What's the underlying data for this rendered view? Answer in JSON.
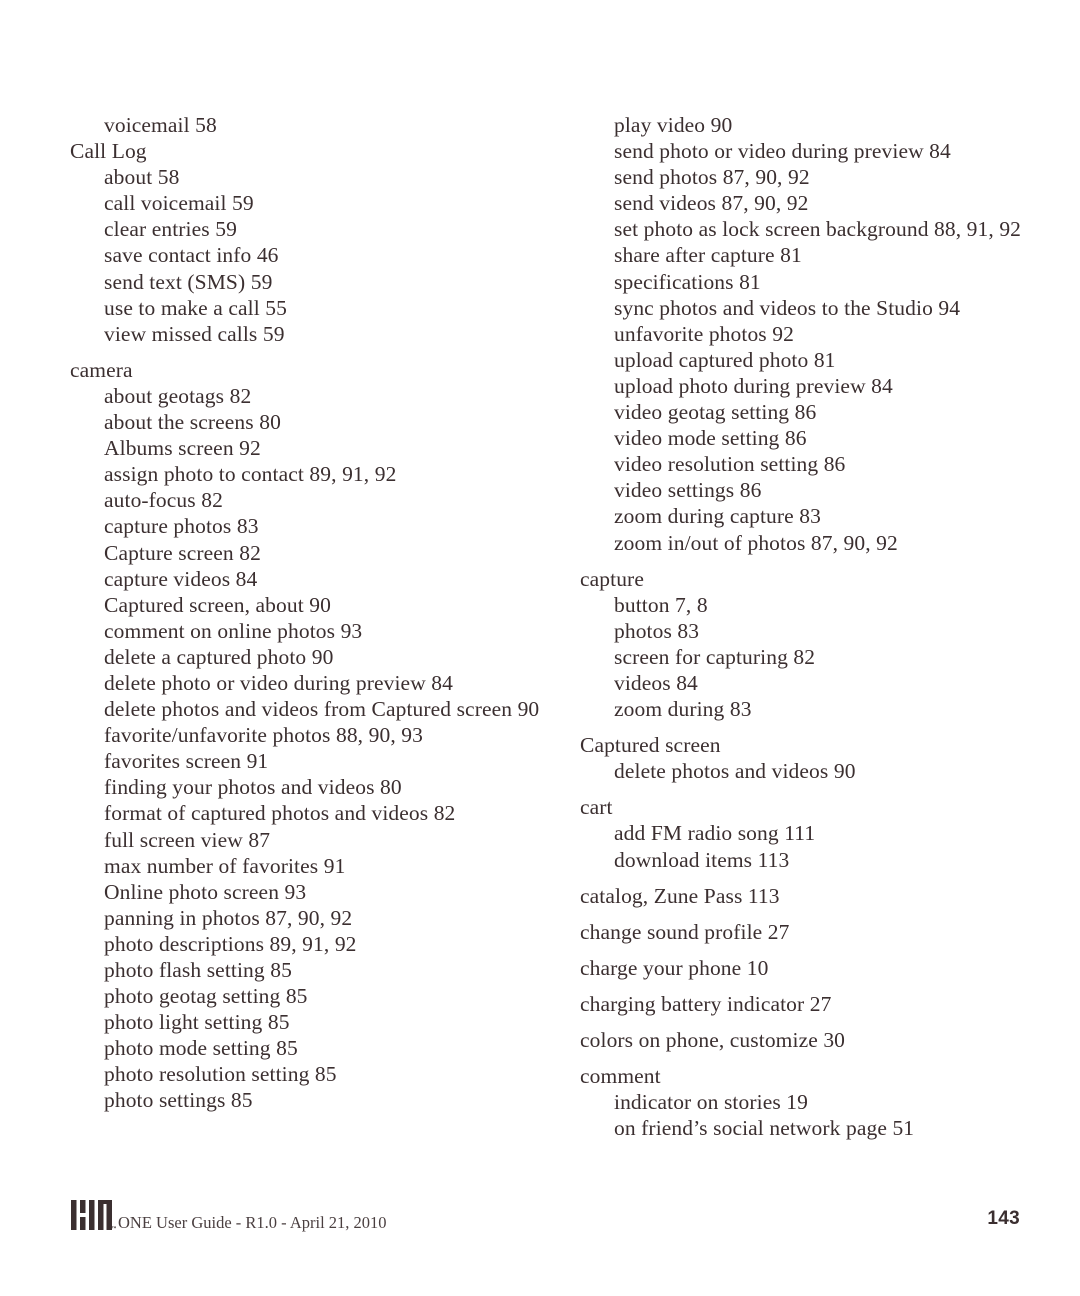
{
  "document": {
    "type": "index",
    "page_number": "143",
    "footer_text": "ONE User Guide - R1.0 - April 21, 2010",
    "logo_name": "KIN",
    "logo_trademark": "TM",
    "text_color": "#3b2f30"
  },
  "columns": [
    {
      "id": "left",
      "entries": [
        {
          "level": 2,
          "text": "voicemail  58"
        },
        {
          "level": 1,
          "text": "Call Log"
        },
        {
          "level": 2,
          "text": "about  58"
        },
        {
          "level": 2,
          "text": "call voicemail  59"
        },
        {
          "level": 2,
          "text": "clear entries  59"
        },
        {
          "level": 2,
          "text": "save contact info  46"
        },
        {
          "level": 2,
          "text": "send text (SMS) 59"
        },
        {
          "level": 2,
          "text": "use to make a call  55"
        },
        {
          "level": 2,
          "text": "view missed calls  59"
        },
        {
          "level": 1,
          "text": "camera",
          "gap": true
        },
        {
          "level": 2,
          "text": "about geotags  82"
        },
        {
          "level": 2,
          "text": "about the screens  80"
        },
        {
          "level": 2,
          "text": "Albums screen  92"
        },
        {
          "level": 2,
          "text": "assign photo to contact  89,  91,  92"
        },
        {
          "level": 2,
          "text": "auto-focus  82"
        },
        {
          "level": 2,
          "text": "capture photos  83"
        },
        {
          "level": 2,
          "text": "Capture screen  82"
        },
        {
          "level": 2,
          "text": "capture videos  84"
        },
        {
          "level": 2,
          "text": "Captured screen, about  90"
        },
        {
          "level": 2,
          "text": "comment on online photos  93"
        },
        {
          "level": 2,
          "text": "delete a captured photo  90"
        },
        {
          "level": 2,
          "text": "delete photo or video during preview  84"
        },
        {
          "level": 2,
          "text": "delete photos and videos from Captured screen  90",
          "wraps": true
        },
        {
          "level": 2,
          "text": "favorite/unfavorite photos  88,  90,  93"
        },
        {
          "level": 2,
          "text": "favorites screen  91"
        },
        {
          "level": 2,
          "text": "finding your photos and videos  80"
        },
        {
          "level": 2,
          "text": "format of captured photos and videos  82"
        },
        {
          "level": 2,
          "text": "full screen view  87"
        },
        {
          "level": 2,
          "text": "max number of favorites  91"
        },
        {
          "level": 2,
          "text": "Online photo screen  93"
        },
        {
          "level": 2,
          "text": "panning in photos  87,  90,  92"
        },
        {
          "level": 2,
          "text": "photo descriptions  89,  91,  92"
        },
        {
          "level": 2,
          "text": "photo flash setting  85"
        },
        {
          "level": 2,
          "text": "photo geotag setting  85"
        },
        {
          "level": 2,
          "text": "photo light setting  85"
        },
        {
          "level": 2,
          "text": "photo mode setting  85"
        },
        {
          "level": 2,
          "text": "photo resolution setting  85"
        },
        {
          "level": 2,
          "text": "photo settings  85"
        }
      ]
    },
    {
      "id": "right",
      "entries": [
        {
          "level": 2,
          "text": "play video  90"
        },
        {
          "level": 2,
          "text": "send photo or video during preview  84"
        },
        {
          "level": 2,
          "text": "send photos  87,  90,  92"
        },
        {
          "level": 2,
          "text": "send videos  87,  90,  92"
        },
        {
          "level": 2,
          "text": "set photo as lock screen background  88,  91, 92",
          "wraps": true
        },
        {
          "level": 2,
          "text": "share after capture  81"
        },
        {
          "level": 2,
          "text": "specifications  81"
        },
        {
          "level": 2,
          "text": "sync photos and videos to the Studio  94"
        },
        {
          "level": 2,
          "text": "unfavorite photos  92"
        },
        {
          "level": 2,
          "text": "upload captured photo  81"
        },
        {
          "level": 2,
          "text": "upload photo during preview  84"
        },
        {
          "level": 2,
          "text": "video geotag setting  86"
        },
        {
          "level": 2,
          "text": "video mode setting  86"
        },
        {
          "level": 2,
          "text": "video resolution setting  86"
        },
        {
          "level": 2,
          "text": "video settings  86"
        },
        {
          "level": 2,
          "text": "zoom during capture  83"
        },
        {
          "level": 2,
          "text": "zoom in/out of photos  87,  90,  92"
        },
        {
          "level": 1,
          "text": "capture",
          "gap": true
        },
        {
          "level": 2,
          "text": "button  7, 8"
        },
        {
          "level": 2,
          "text": "photos  83"
        },
        {
          "level": 2,
          "text": "screen for capturing  82"
        },
        {
          "level": 2,
          "text": "videos  84"
        },
        {
          "level": 2,
          "text": "zoom during  83"
        },
        {
          "level": 1,
          "text": "Captured screen",
          "gap": true
        },
        {
          "level": 2,
          "text": "delete photos and videos  90"
        },
        {
          "level": 1,
          "text": "cart",
          "gap": true
        },
        {
          "level": 2,
          "text": "add FM radio song  111"
        },
        {
          "level": 2,
          "text": "download items  113"
        },
        {
          "level": 1,
          "text": "catalog, Zune Pass  113",
          "solo": true
        },
        {
          "level": 1,
          "text": "change sound profile  27",
          "solo": true
        },
        {
          "level": 1,
          "text": "charge your phone  10",
          "solo": true
        },
        {
          "level": 1,
          "text": "charging battery indicator  27",
          "solo": true
        },
        {
          "level": 1,
          "text": "colors on phone, customize  30",
          "solo": true
        },
        {
          "level": 1,
          "text": "comment",
          "solo": true
        },
        {
          "level": 2,
          "text": "indicator on stories  19"
        },
        {
          "level": 2,
          "text": "on friend’s social network page  51"
        }
      ]
    }
  ]
}
